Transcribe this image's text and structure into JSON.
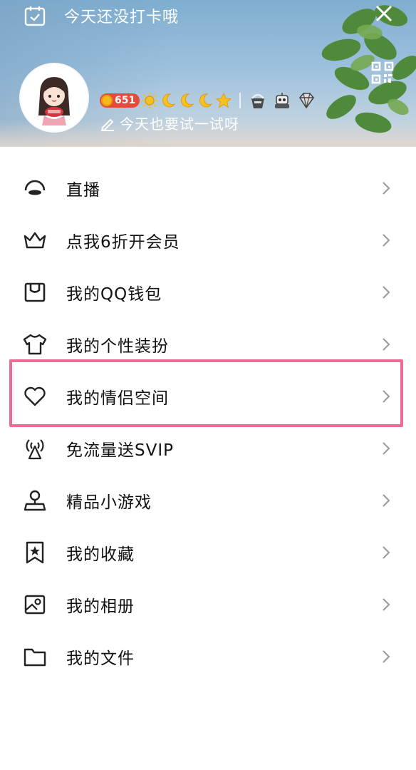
{
  "header": {
    "checkin_text": "今天还没打卡哦",
    "checkin_icon": "calendar-check-icon",
    "close_icon": "close-icon",
    "qr_icon": "qr-code-icon",
    "level_badge": "651",
    "signature": "今天也要试一试呀",
    "colors": {
      "sky": "#8fb6d6",
      "coin_badge": "#e84a3a",
      "coin": "#f6b91c",
      "moon": "#f6c21c"
    }
  },
  "menu": {
    "items": [
      {
        "label": "直播",
        "icon": "live-icon"
      },
      {
        "label": "点我6折开会员",
        "icon": "crown-icon"
      },
      {
        "label": "我的QQ钱包",
        "icon": "wallet-icon"
      },
      {
        "label": "我的个性装扮",
        "icon": "tshirt-icon"
      },
      {
        "label": "我的情侣空间",
        "icon": "heart-icon"
      },
      {
        "label": "免流量送SVIP",
        "icon": "signal-tower-icon"
      },
      {
        "label": "精品小游戏",
        "icon": "game-pin-icon"
      },
      {
        "label": "我的收藏",
        "icon": "bookmark-star-icon"
      },
      {
        "label": "我的相册",
        "icon": "photo-album-icon"
      },
      {
        "label": "我的文件",
        "icon": "folder-icon"
      }
    ],
    "chevron_icon": "chevron-right-icon",
    "highlight_color": "#ee6b96"
  }
}
